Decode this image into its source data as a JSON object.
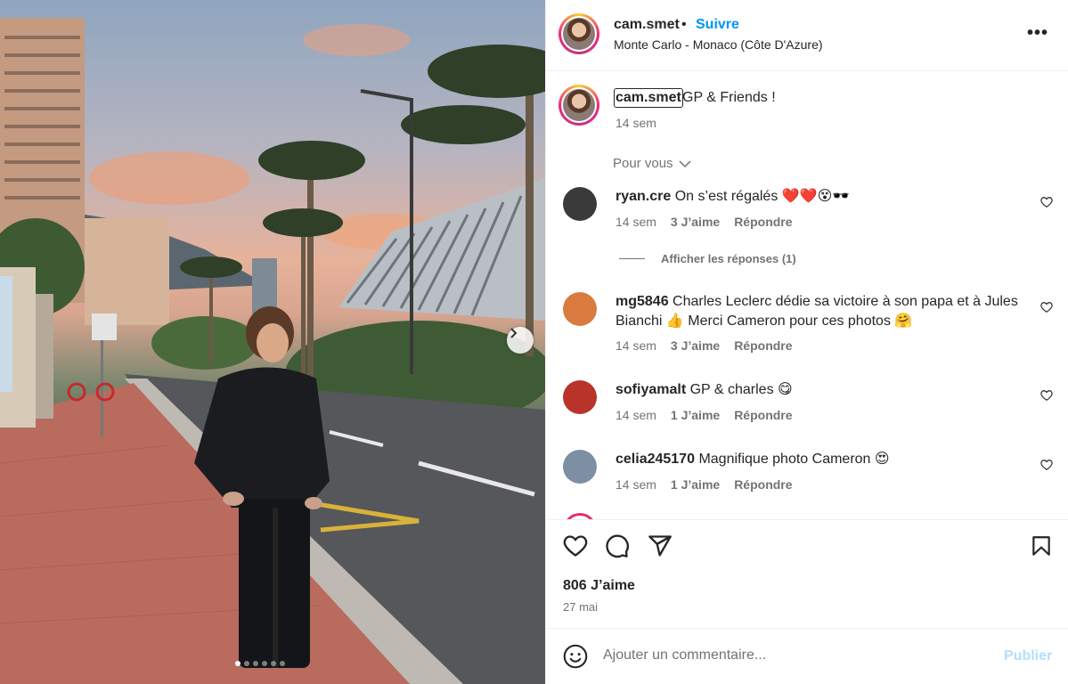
{
  "post": {
    "username": "cam.smet",
    "separator": "•",
    "follow_label": "Suivre",
    "location": "Monte Carlo - Monaco (Côte D'Azure)",
    "more_icon": "more-horizontal-icon",
    "caption_user": "cam.smet",
    "caption_text": "GP & Friends !",
    "caption_time": "14 sem",
    "carousel": {
      "total": 6,
      "active": 1
    }
  },
  "pour_vous": "Pour vous",
  "view_replies": "Afficher les réponses (1)",
  "comments": [
    {
      "user": "ryan.cre",
      "text": "On s’est régalés ❤️❤️😵🕶️",
      "time": "14 sem",
      "likes": "3 J’aime",
      "reply": "Répondre",
      "avatar_color": "#3b3a3a"
    },
    {
      "user": "mg5846",
      "text": "Charles Leclerc dédie sa victoire à son papa et à Jules Bianchi 👍 Merci Cameron pour ces photos 🤗",
      "time": "14 sem",
      "likes": "3 J’aime",
      "reply": "Répondre",
      "avatar_color": "#d97a3f"
    },
    {
      "user": "sofiyamalt",
      "text": "GP & charles 😋",
      "time": "14 sem",
      "likes": "1 J’aime",
      "reply": "Répondre",
      "avatar_color": "#b9332b"
    },
    {
      "user": "celia245170",
      "text": "Magnifique photo Cameron 😍",
      "time": "14 sem",
      "likes": "1 J’aime",
      "reply": "Répondre",
      "avatar_color": "#7c8fa3"
    }
  ],
  "actions": {
    "likes": "806 J’aime",
    "date": "27 mai"
  },
  "add_comment": {
    "placeholder": "Ajouter un commentaire...",
    "publish_label": "Publier"
  },
  "colors": {
    "accent": "#0095f6",
    "text": "#262626",
    "muted": "#737373",
    "publish_disabled": "#b2dffc"
  }
}
